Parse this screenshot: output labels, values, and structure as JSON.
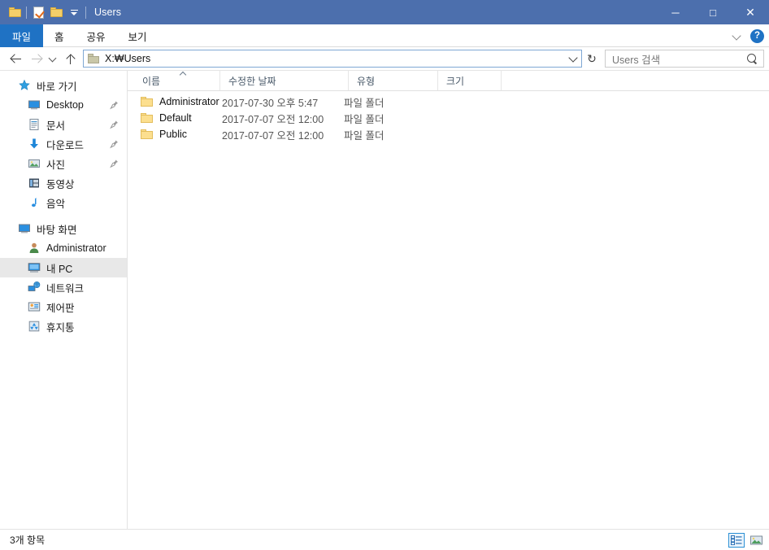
{
  "window": {
    "title": "Users",
    "titlebar_color": "#4c6fad",
    "quick_access": [
      {
        "name": "folder-icon",
        "label": "Folder"
      },
      {
        "name": "properties-icon",
        "label": "Properties"
      },
      {
        "name": "new-folder-icon",
        "label": "New folder"
      },
      {
        "name": "customize-quick-access-toolbar",
        "label": "Customize Quick Access Toolbar"
      }
    ],
    "controls": {
      "minimize": "─",
      "maximize": "□",
      "close": "✕"
    }
  },
  "ribbon": {
    "tabs": [
      {
        "label": "파일",
        "active": true
      },
      {
        "label": "홈",
        "active": false
      },
      {
        "label": "공유",
        "active": false
      },
      {
        "label": "보기",
        "active": false
      }
    ],
    "minimize_ribbon_icon": "chevron-down-icon",
    "help_label": "?"
  },
  "navigation": {
    "back_icon": "arrow-left-icon",
    "forward_icon": "arrow-right-icon",
    "recent_icon": "chevron-down-icon",
    "up_icon": "arrow-up-icon",
    "address": {
      "value": "X:\\Users",
      "display": "X:₩Users",
      "dropdown_icon": "chevron-down-icon"
    },
    "refresh_icon": "↻",
    "search": {
      "placeholder": "Users 검색",
      "value": "",
      "icon": "search-icon"
    }
  },
  "sidebar": {
    "items": [
      {
        "label": "바로 가기",
        "icon": "star-icon",
        "indent": false,
        "pinned": false,
        "selected": false
      },
      {
        "label": "Desktop",
        "icon": "desktop-icon",
        "indent": true,
        "pinned": true,
        "selected": false
      },
      {
        "label": "문서",
        "icon": "documents-icon",
        "indent": true,
        "pinned": true,
        "selected": false
      },
      {
        "label": "다운로드",
        "icon": "downloads-icon",
        "indent": true,
        "pinned": true,
        "selected": false
      },
      {
        "label": "사진",
        "icon": "pictures-icon",
        "indent": true,
        "pinned": true,
        "selected": false
      },
      {
        "label": "동영상",
        "icon": "videos-icon",
        "indent": true,
        "pinned": false,
        "selected": false
      },
      {
        "label": "음악",
        "icon": "music-icon",
        "indent": true,
        "pinned": false,
        "selected": false
      },
      {
        "label": "바탕 화면",
        "icon": "desktop-icon",
        "indent": false,
        "pinned": false,
        "selected": false
      },
      {
        "label": "Administrator",
        "icon": "user-icon",
        "indent": true,
        "pinned": false,
        "selected": false
      },
      {
        "label": "내 PC",
        "icon": "this-pc-icon",
        "indent": true,
        "pinned": false,
        "selected": true
      },
      {
        "label": "네트워크",
        "icon": "network-icon",
        "indent": true,
        "pinned": false,
        "selected": false
      },
      {
        "label": "제어판",
        "icon": "control-panel-icon",
        "indent": true,
        "pinned": false,
        "selected": false
      },
      {
        "label": "휴지통",
        "icon": "recycle-bin-icon",
        "indent": true,
        "pinned": false,
        "selected": false
      }
    ],
    "pin_glyph": "📌"
  },
  "file_list": {
    "columns": [
      {
        "label": "이름",
        "key": "name",
        "sorted": true,
        "sort_direction": "asc"
      },
      {
        "label": "수정한 날짜",
        "key": "date",
        "sorted": false
      },
      {
        "label": "유형",
        "key": "type",
        "sorted": false
      },
      {
        "label": "크기",
        "key": "size",
        "sorted": false
      }
    ],
    "rows": [
      {
        "name": "Administrator",
        "date": "2017-07-30 오후 5:47",
        "type": "파일 폴더",
        "size": "",
        "icon": "folder-icon"
      },
      {
        "name": "Default",
        "date": "2017-07-07 오전 12:00",
        "type": "파일 폴더",
        "size": "",
        "icon": "folder-icon"
      },
      {
        "name": "Public",
        "date": "2017-07-07 오전 12:00",
        "type": "파일 폴더",
        "size": "",
        "icon": "folder-icon"
      }
    ]
  },
  "status": {
    "item_count_text": "3개 항목",
    "views": [
      {
        "name": "details-view",
        "active": true
      },
      {
        "name": "large-icons-view",
        "active": false
      }
    ]
  }
}
